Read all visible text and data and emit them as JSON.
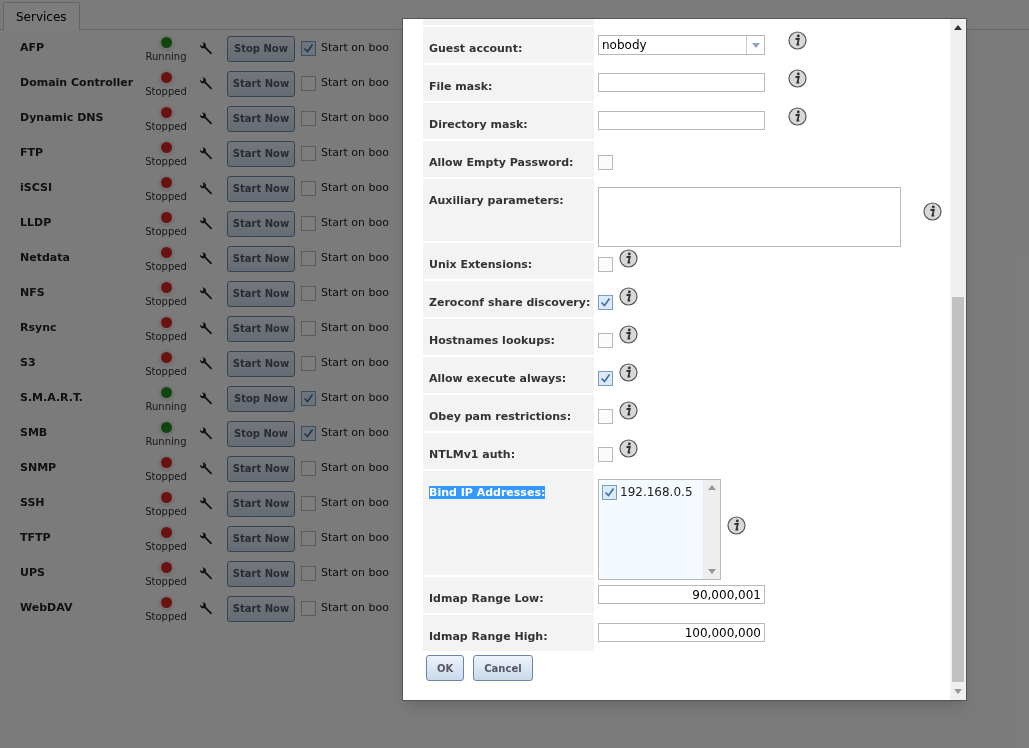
{
  "tabs": [
    {
      "label": "Services",
      "selected": true
    }
  ],
  "services": [
    {
      "name": "AFP",
      "status": "Running",
      "running": true,
      "button": "Stop Now",
      "start_on_boot": true,
      "boot_label": "Start on boo"
    },
    {
      "name": "Domain Controller",
      "status": "Stopped",
      "running": false,
      "button": "Start Now",
      "start_on_boot": false,
      "boot_label": "Start on boo"
    },
    {
      "name": "Dynamic DNS",
      "status": "Stopped",
      "running": false,
      "button": "Start Now",
      "start_on_boot": false,
      "boot_label": "Start on boo"
    },
    {
      "name": "FTP",
      "status": "Stopped",
      "running": false,
      "button": "Start Now",
      "start_on_boot": false,
      "boot_label": "Start on boo"
    },
    {
      "name": "iSCSI",
      "status": "Stopped",
      "running": false,
      "button": "Start Now",
      "start_on_boot": false,
      "boot_label": "Start on boo"
    },
    {
      "name": "LLDP",
      "status": "Stopped",
      "running": false,
      "button": "Start Now",
      "start_on_boot": false,
      "boot_label": "Start on boo"
    },
    {
      "name": "Netdata",
      "status": "Stopped",
      "running": false,
      "button": "Start Now",
      "start_on_boot": false,
      "boot_label": "Start on boo"
    },
    {
      "name": "NFS",
      "status": "Stopped",
      "running": false,
      "button": "Start Now",
      "start_on_boot": false,
      "boot_label": "Start on boo"
    },
    {
      "name": "Rsync",
      "status": "Stopped",
      "running": false,
      "button": "Start Now",
      "start_on_boot": false,
      "boot_label": "Start on boo"
    },
    {
      "name": "S3",
      "status": "Stopped",
      "running": false,
      "button": "Start Now",
      "start_on_boot": false,
      "boot_label": "Start on boo"
    },
    {
      "name": "S.M.A.R.T.",
      "status": "Running",
      "running": true,
      "button": "Stop Now",
      "start_on_boot": true,
      "boot_label": "Start on boo"
    },
    {
      "name": "SMB",
      "status": "Running",
      "running": true,
      "button": "Stop Now",
      "start_on_boot": true,
      "boot_label": "Start on boo"
    },
    {
      "name": "SNMP",
      "status": "Stopped",
      "running": false,
      "button": "Start Now",
      "start_on_boot": false,
      "boot_label": "Start on boo"
    },
    {
      "name": "SSH",
      "status": "Stopped",
      "running": false,
      "button": "Start Now",
      "start_on_boot": false,
      "boot_label": "Start on boo"
    },
    {
      "name": "TFTP",
      "status": "Stopped",
      "running": false,
      "button": "Start Now",
      "start_on_boot": false,
      "boot_label": "Start on boo"
    },
    {
      "name": "UPS",
      "status": "Stopped",
      "running": false,
      "button": "Start Now",
      "start_on_boot": false,
      "boot_label": "Start on boo"
    },
    {
      "name": "WebDAV",
      "status": "Stopped",
      "running": false,
      "button": "Start Now",
      "start_on_boot": false,
      "boot_label": "Start on boo"
    }
  ],
  "dialog": {
    "fields": [
      {
        "kind": "select",
        "label": "Guest account:",
        "value": "nobody",
        "info": true
      },
      {
        "kind": "text",
        "label": "File mask:",
        "info": true
      },
      {
        "kind": "text",
        "label": "Directory mask:",
        "info": true
      },
      {
        "kind": "checkbox",
        "label": "Allow Empty Password:",
        "checked": false,
        "info": false
      },
      {
        "kind": "textarea",
        "label": "Auxiliary parameters:",
        "info": true
      },
      {
        "kind": "checkbox",
        "label": "Unix Extensions:",
        "checked": false,
        "info": true
      },
      {
        "kind": "checkbox",
        "label": "Zeroconf share discovery:",
        "checked": true,
        "info": true
      },
      {
        "kind": "checkbox",
        "label": "Hostnames lookups:",
        "checked": false,
        "info": true
      },
      {
        "kind": "checkbox",
        "label": "Allow execute always:",
        "checked": true,
        "info": true
      },
      {
        "kind": "checkbox",
        "label": "Obey pam restrictions:",
        "checked": false,
        "info": true
      },
      {
        "kind": "checkbox",
        "label": "NTLMv1 auth:",
        "checked": false,
        "info": true
      },
      {
        "kind": "listbox",
        "label": "Bind IP Addresses:",
        "highlighted": true,
        "items": [
          {
            "label": "192.168.0.5",
            "checked": true
          }
        ],
        "info": true
      },
      {
        "kind": "number",
        "label": "Idmap Range Low:",
        "value": "90,000,001",
        "info": false
      },
      {
        "kind": "number",
        "label": "Idmap Range High:",
        "value": "100,000,000",
        "info": false
      }
    ],
    "buttons": [
      {
        "label": "OK"
      },
      {
        "label": "Cancel"
      }
    ]
  }
}
